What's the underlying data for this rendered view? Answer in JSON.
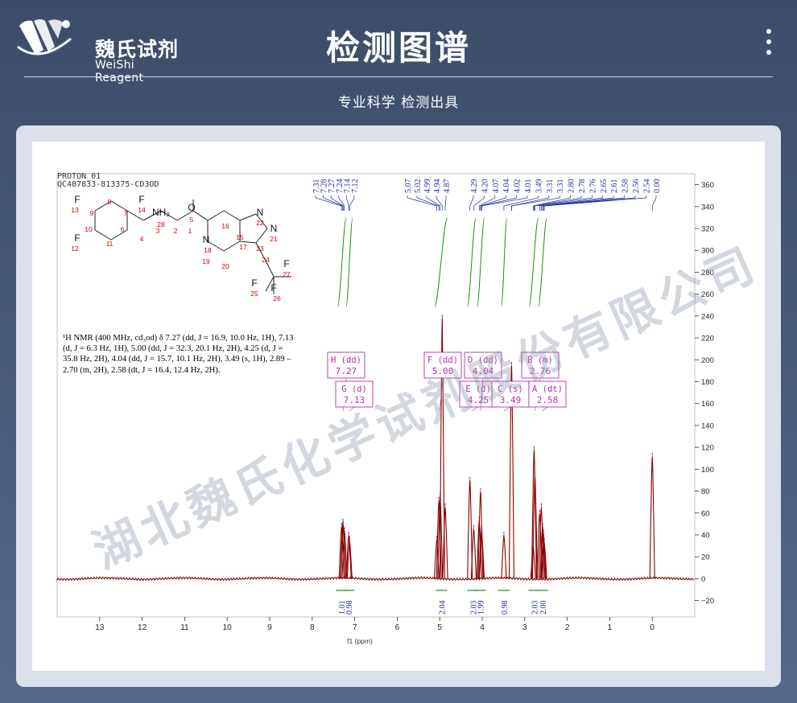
{
  "header": {
    "brand_cn": "魏氏试剂",
    "brand_en": "WeiShi Reagent",
    "title": "检测图谱",
    "subtitle": "专业科学  检测出具"
  },
  "spectrum": {
    "header_line1": "PROTON_01",
    "header_line2": "QC487833-813375-CD3OD",
    "nmr_description": "¹H NMR (400 MHz, cd₃od) δ 7.27 (dd, J = 16.9, 10.0 Hz, 1H), 7.13 (d, J = 6.3 Hz, 1H), 5.00 (dd, J = 32.3, 20.1 Hz, 2H), 4.25 (d, J = 35.8 Hz, 2H), 4.04 (dd, J = 15.7, 10.1 Hz, 2H), 3.49 (s, 1H), 2.89 – 2.70 (m, 2H), 2.58 (dt, J = 16.4, 12.4 Hz, 2H).",
    "x_axis_label": "f1 (ppm)",
    "peak_labels": [
      "7.31",
      "7.28",
      "7.27",
      "7.24",
      "7.14",
      "7.12",
      "5.07",
      "5.02",
      "4.99",
      "4.94",
      "4.87",
      "4.29",
      "4.20",
      "4.07",
      "4.04",
      "4.02",
      "4.01",
      "3.49",
      "3.31",
      "3.31",
      "2.80",
      "2.78",
      "2.76",
      "2.65",
      "2.61",
      "2.58",
      "2.56",
      "2.54",
      "0.00"
    ],
    "multiplets": [
      {
        "letter": "H",
        "mult": "dd",
        "shift": "7.27"
      },
      {
        "letter": "G",
        "mult": "d",
        "shift": "7.13"
      },
      {
        "letter": "F",
        "mult": "dd",
        "shift": "5.00"
      },
      {
        "letter": "E",
        "mult": "d",
        "shift": "4.25"
      },
      {
        "letter": "D",
        "mult": "dd",
        "shift": "4.04"
      },
      {
        "letter": "C",
        "mult": "s",
        "shift": "3.49"
      },
      {
        "letter": "B",
        "mult": "m",
        "shift": "2.76"
      },
      {
        "letter": "A",
        "mult": "dt",
        "shift": "2.58"
      }
    ],
    "integrals": [
      "1.01",
      "0.98",
      "2.04",
      "2.03",
      "1.99",
      "0.98",
      "2.03",
      "2.00"
    ],
    "molecule_labels": [
      "F",
      "13",
      "9",
      "8",
      "7",
      "F",
      "14",
      "NH₂",
      "28",
      "O",
      "5",
      "F",
      "12",
      "10",
      "11",
      "6",
      "4",
      "3",
      "2",
      "1",
      "16",
      "N",
      "18",
      "19",
      "20",
      "15",
      "N",
      "22",
      "N",
      "21",
      "17",
      "23",
      "24",
      "F",
      "27",
      "F",
      "26",
      "F",
      "25"
    ],
    "watermark": "湖北魏氏化学试剂股份有限公司"
  },
  "chart_data": {
    "type": "line",
    "title": "",
    "xlabel": "f1 (ppm)",
    "ylabel": "",
    "xlim": [
      14,
      -1
    ],
    "ylim": [
      -35,
      370
    ],
    "x_ticks": [
      13,
      12,
      11,
      10,
      9,
      8,
      7,
      6,
      5,
      4,
      3,
      2,
      1,
      0
    ],
    "y_ticks": [
      -20,
      0,
      20,
      40,
      60,
      80,
      100,
      120,
      140,
      160,
      180,
      200,
      220,
      240,
      260,
      280,
      300,
      320,
      340,
      360
    ],
    "peaks": [
      {
        "x": 7.31,
        "y": 48
      },
      {
        "x": 7.28,
        "y": 52
      },
      {
        "x": 7.27,
        "y": 50
      },
      {
        "x": 7.24,
        "y": 44
      },
      {
        "x": 7.14,
        "y": 40
      },
      {
        "x": 7.12,
        "y": 36
      },
      {
        "x": 5.07,
        "y": 36
      },
      {
        "x": 5.02,
        "y": 72
      },
      {
        "x": 4.99,
        "y": 75
      },
      {
        "x": 4.94,
        "y": 238
      },
      {
        "x": 4.87,
        "y": 66
      },
      {
        "x": 4.29,
        "y": 90
      },
      {
        "x": 4.2,
        "y": 46
      },
      {
        "x": 4.07,
        "y": 54
      },
      {
        "x": 4.04,
        "y": 80
      },
      {
        "x": 4.02,
        "y": 44
      },
      {
        "x": 4.01,
        "y": 40
      },
      {
        "x": 3.49,
        "y": 40
      },
      {
        "x": 3.31,
        "y": 195
      },
      {
        "x": 2.8,
        "y": 30
      },
      {
        "x": 2.78,
        "y": 118
      },
      {
        "x": 2.76,
        "y": 94
      },
      {
        "x": 2.65,
        "y": 60
      },
      {
        "x": 2.61,
        "y": 66
      },
      {
        "x": 2.58,
        "y": 48
      },
      {
        "x": 2.56,
        "y": 42
      },
      {
        "x": 2.54,
        "y": 34
      },
      {
        "x": 0.0,
        "y": 112
      }
    ],
    "integral_curves": [
      {
        "from": 7.4,
        "to": 7.2
      },
      {
        "from": 7.2,
        "to": 7.05
      },
      {
        "from": 5.12,
        "to": 4.82
      },
      {
        "from": 4.35,
        "to": 4.15
      },
      {
        "from": 4.12,
        "to": 3.95
      },
      {
        "from": 3.55,
        "to": 3.42
      },
      {
        "from": 2.9,
        "to": 2.68
      },
      {
        "from": 2.68,
        "to": 2.48
      }
    ],
    "colors": {
      "spectrum": "#8b0000",
      "peak_labels": "#1f2f9e",
      "integral": "#1a8f1a",
      "multiplet_box": "#b030b0"
    }
  }
}
